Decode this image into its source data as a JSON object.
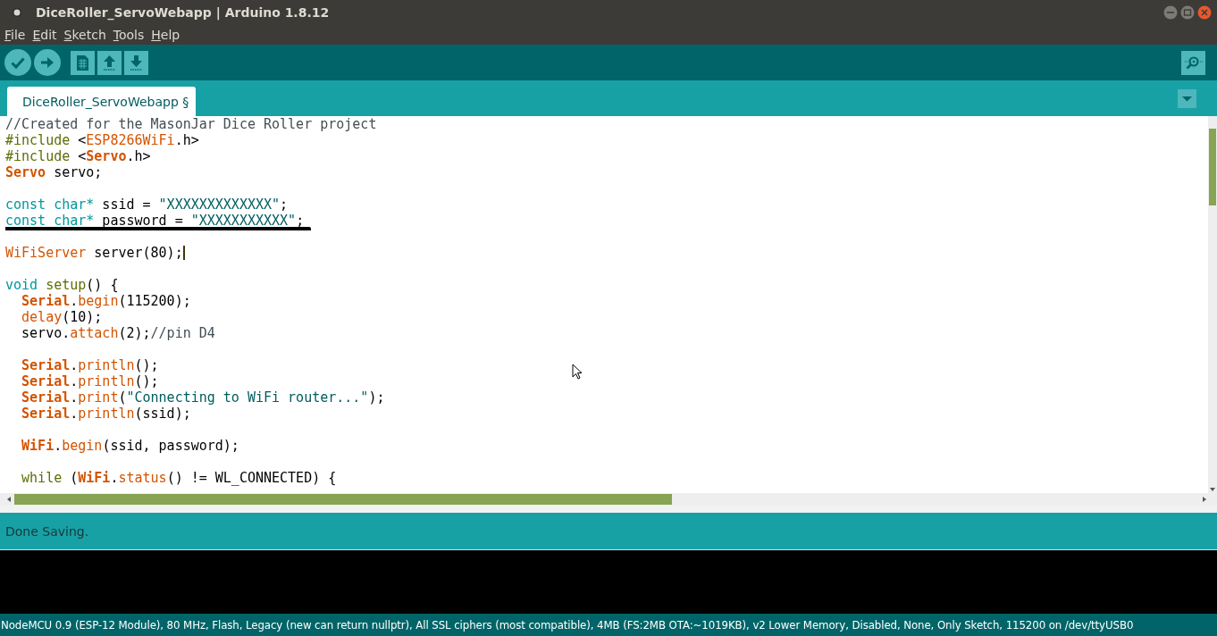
{
  "window": {
    "title": "DiceRoller_ServoWebapp | Arduino 1.8.12"
  },
  "menu": [
    "File",
    "Edit",
    "Sketch",
    "Tools",
    "Help"
  ],
  "toolbar": [
    {
      "kind": "verify"
    },
    {
      "kind": "upload"
    },
    {
      "kind": "new"
    },
    {
      "kind": "open"
    },
    {
      "kind": "save"
    }
  ],
  "tabs": [
    {
      "label": "DiceRoller_ServoWebapp §",
      "selected": true
    }
  ],
  "editor": {
    "lines": [
      {
        "kind": "code",
        "tokens": [
          {
            "kind": "comment",
            "text": "//Created for the MasonJar Dice Roller project"
          }
        ]
      },
      {
        "kind": "code",
        "tokens": [
          {
            "kind": "struct",
            "text": "#include"
          },
          {
            "kind": "plain",
            "text": " <"
          },
          {
            "kind": "func",
            "text": "ESP8266WiFi"
          },
          {
            "kind": "plain",
            "text": ".h>"
          }
        ]
      },
      {
        "kind": "code",
        "tokens": [
          {
            "kind": "struct",
            "text": "#include"
          },
          {
            "kind": "plain",
            "text": " <"
          },
          {
            "kind": "class",
            "text": "Servo"
          },
          {
            "kind": "plain",
            "text": ".h>"
          }
        ]
      },
      {
        "kind": "code",
        "tokens": [
          {
            "kind": "class",
            "text": "Servo"
          },
          {
            "kind": "plain",
            "text": " servo;"
          }
        ]
      },
      {
        "kind": "blank"
      },
      {
        "kind": "code",
        "tokens": [
          {
            "kind": "type",
            "text": "const"
          },
          {
            "kind": "type",
            "text": " char*"
          },
          {
            "kind": "plain",
            "text": " ssid = "
          },
          {
            "kind": "string",
            "text": "\"XXXXXXXXXXXXX\""
          },
          {
            "kind": "plain",
            "text": ";"
          }
        ]
      },
      {
        "kind": "code",
        "tokens": [
          {
            "kind": "type",
            "text": "const"
          },
          {
            "kind": "type",
            "text": " char*"
          },
          {
            "kind": "plain",
            "text": " password = "
          },
          {
            "kind": "string",
            "text": "\"XXXXXXXXXXX\""
          },
          {
            "kind": "plain",
            "text": ";"
          }
        ]
      },
      {
        "kind": "blank"
      },
      {
        "kind": "code",
        "tokens": [
          {
            "kind": "func",
            "text": "WiFiServer"
          },
          {
            "kind": "plain",
            "text": " server(80);"
          }
        ]
      },
      {
        "kind": "blank"
      },
      {
        "kind": "code",
        "tokens": [
          {
            "kind": "type",
            "text": "void"
          },
          {
            "kind": "struct",
            "text": " setup"
          },
          {
            "kind": "plain",
            "text": "() {"
          }
        ]
      },
      {
        "kind": "code",
        "tokens": [
          {
            "kind": "class",
            "text": "  Serial"
          },
          {
            "kind": "plain",
            "text": "."
          },
          {
            "kind": "func",
            "text": "begin"
          },
          {
            "kind": "plain",
            "text": "(115200);"
          }
        ]
      },
      {
        "kind": "code",
        "tokens": [
          {
            "kind": "func",
            "text": "  delay"
          },
          {
            "kind": "plain",
            "text": "(10);"
          }
        ]
      },
      {
        "kind": "code",
        "tokens": [
          {
            "kind": "plain",
            "text": "  servo."
          },
          {
            "kind": "func",
            "text": "attach"
          },
          {
            "kind": "plain",
            "text": "(2);"
          },
          {
            "kind": "comment",
            "text": "//pin D4"
          }
        ]
      },
      {
        "kind": "blank"
      },
      {
        "kind": "code",
        "tokens": [
          {
            "kind": "class",
            "text": "  Serial"
          },
          {
            "kind": "plain",
            "text": "."
          },
          {
            "kind": "func",
            "text": "println"
          },
          {
            "kind": "plain",
            "text": "();"
          }
        ]
      },
      {
        "kind": "code",
        "tokens": [
          {
            "kind": "class",
            "text": "  Serial"
          },
          {
            "kind": "plain",
            "text": "."
          },
          {
            "kind": "func",
            "text": "println"
          },
          {
            "kind": "plain",
            "text": "();"
          }
        ]
      },
      {
        "kind": "code",
        "tokens": [
          {
            "kind": "class",
            "text": "  Serial"
          },
          {
            "kind": "plain",
            "text": "."
          },
          {
            "kind": "func",
            "text": "print"
          },
          {
            "kind": "plain",
            "text": "("
          },
          {
            "kind": "string",
            "text": "\"Connecting to WiFi router...\""
          },
          {
            "kind": "plain",
            "text": ");"
          }
        ]
      },
      {
        "kind": "code",
        "tokens": [
          {
            "kind": "class",
            "text": "  Serial"
          },
          {
            "kind": "plain",
            "text": "."
          },
          {
            "kind": "func",
            "text": "println"
          },
          {
            "kind": "plain",
            "text": "(ssid);"
          }
        ]
      },
      {
        "kind": "blank"
      },
      {
        "kind": "code",
        "tokens": [
          {
            "kind": "class",
            "text": "  WiFi"
          },
          {
            "kind": "plain",
            "text": "."
          },
          {
            "kind": "func",
            "text": "begin"
          },
          {
            "kind": "plain",
            "text": "(ssid, password);"
          }
        ]
      },
      {
        "kind": "blank"
      },
      {
        "kind": "code",
        "tokens": [
          {
            "kind": "struct",
            "text": "  while"
          },
          {
            "kind": "plain",
            "text": " ("
          },
          {
            "kind": "class",
            "text": "WiFi"
          },
          {
            "kind": "plain",
            "text": "."
          },
          {
            "kind": "func",
            "text": "status"
          },
          {
            "kind": "plain",
            "text": "() != WL_CONNECTED) {"
          }
        ]
      }
    ]
  },
  "message": "Done Saving.",
  "board_status": "NodeMCU 0.9 (ESP-12 Module), 80 MHz, Flash, Legacy (new can return nullptr), All SSL ciphers (most compatible), 4MB (FS:2MB OTA:~1019KB), v2 Lower Memory, Disabled, None, Only Sketch, 115200 on /dev/ttyUSB0"
}
